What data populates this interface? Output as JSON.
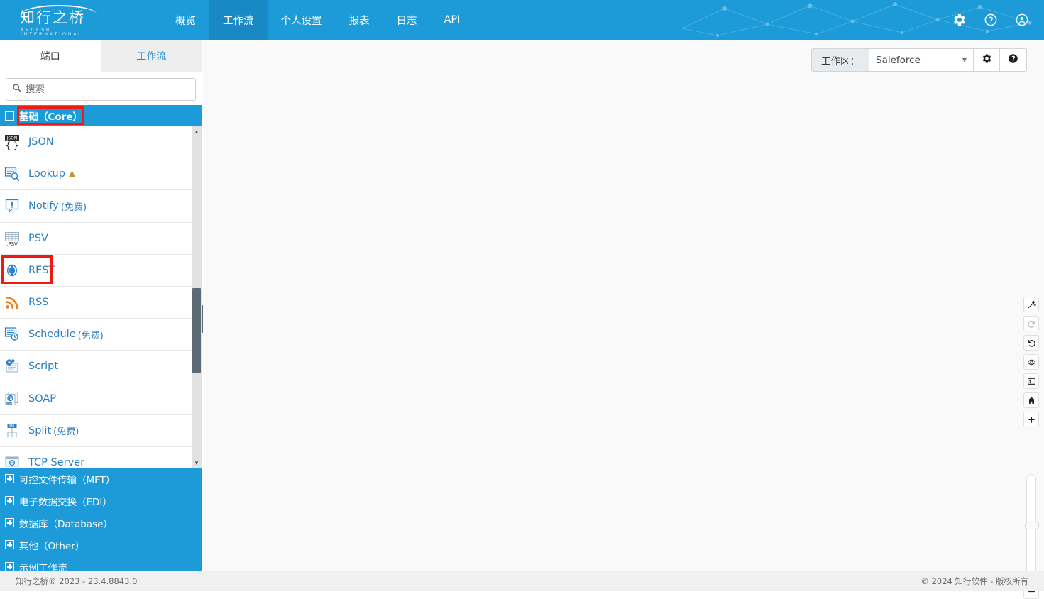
{
  "brand": {
    "logo_cn": "知行之桥",
    "logo_en": "ARCESB INTERNATIONAL",
    "accent_color": "#1d9bd9",
    "highlight_color": "#ee1b14"
  },
  "header": {
    "nav": [
      {
        "label": "概览",
        "active": false,
        "name": "nav-overview"
      },
      {
        "label": "工作流",
        "active": true,
        "name": "nav-workflow"
      },
      {
        "label": "个人设置",
        "active": false,
        "name": "nav-profile-settings"
      },
      {
        "label": "报表",
        "active": false,
        "name": "nav-reports"
      },
      {
        "label": "日志",
        "active": false,
        "name": "nav-logs"
      },
      {
        "label": "API",
        "active": false,
        "name": "nav-api"
      }
    ],
    "icons": [
      {
        "name": "gear-icon",
        "glyph": "settings"
      },
      {
        "name": "help-circle-icon",
        "glyph": "help"
      },
      {
        "name": "account-icon",
        "glyph": "account"
      }
    ]
  },
  "left_panel": {
    "tabs": [
      {
        "label": "端口",
        "active": true,
        "name": "tab-ports"
      },
      {
        "label": "工作流",
        "active": false,
        "name": "tab-workflows"
      }
    ],
    "search": {
      "placeholder": "搜索",
      "value": "",
      "icon": "search-icon"
    },
    "expanded_category": {
      "label": "基础（Core）",
      "expanded": true,
      "highlighted": true
    },
    "ports": [
      {
        "label": "JSON",
        "suffix": "",
        "icon": "json-icon",
        "warning": false,
        "highlighted": false
      },
      {
        "label": "Lookup",
        "suffix": "",
        "icon": "lookup-icon",
        "warning": true,
        "highlighted": false
      },
      {
        "label": "Notify",
        "suffix": "(免费)",
        "icon": "notify-icon",
        "warning": false,
        "highlighted": false
      },
      {
        "label": "PSV",
        "suffix": "",
        "icon": "psv-icon",
        "warning": false,
        "highlighted": false
      },
      {
        "label": "REST",
        "suffix": "",
        "icon": "rest-icon",
        "warning": false,
        "highlighted": true
      },
      {
        "label": "RSS",
        "suffix": "",
        "icon": "rss-icon",
        "warning": false,
        "highlighted": false
      },
      {
        "label": "Schedule",
        "suffix": "(免费)",
        "icon": "schedule-icon",
        "warning": false,
        "highlighted": false
      },
      {
        "label": "Script",
        "suffix": "",
        "icon": "script-icon",
        "warning": false,
        "highlighted": false
      },
      {
        "label": "SOAP",
        "suffix": "",
        "icon": "soap-icon",
        "warning": false,
        "highlighted": false
      },
      {
        "label": "Split",
        "suffix": "(免费)",
        "icon": "split-icon",
        "warning": false,
        "highlighted": false
      },
      {
        "label": "TCP Server",
        "suffix": "",
        "icon": "tcp-server-icon",
        "warning": false,
        "highlighted": false
      }
    ],
    "collapsed_categories": [
      {
        "label": "可控文件传输（MFT）",
        "name": "category-mft"
      },
      {
        "label": "电子数据交换（EDI）",
        "name": "category-edi"
      },
      {
        "label": "数据库（Database）",
        "name": "category-database"
      },
      {
        "label": "其他（Other）",
        "name": "category-other"
      },
      {
        "label": "示例工作流",
        "name": "category-sample-workflows"
      }
    ],
    "collapse_handle": {
      "icon": "chevron-left-icon"
    }
  },
  "workspace_bar": {
    "label": "工作区：",
    "selected": "Saleforce",
    "caret": "chevron-down-icon",
    "settings_icon": "gear-icon",
    "help_icon": "help-circle-icon"
  },
  "canvas_tools": [
    {
      "name": "magic-wand-icon"
    },
    {
      "name": "redo-icon"
    },
    {
      "name": "undo-icon"
    },
    {
      "name": "eye-icon"
    },
    {
      "name": "image-export-icon"
    },
    {
      "name": "home-icon"
    },
    {
      "name": "zoom-in-icon"
    }
  ],
  "zoom_control": {
    "minus_icon": "zoom-out-icon",
    "slider": "zoom-slider"
  },
  "footer": {
    "left": "知行之桥® 2023 - 23.4.8843.0",
    "right": "© 2024 知行软件 - 版权所有"
  }
}
